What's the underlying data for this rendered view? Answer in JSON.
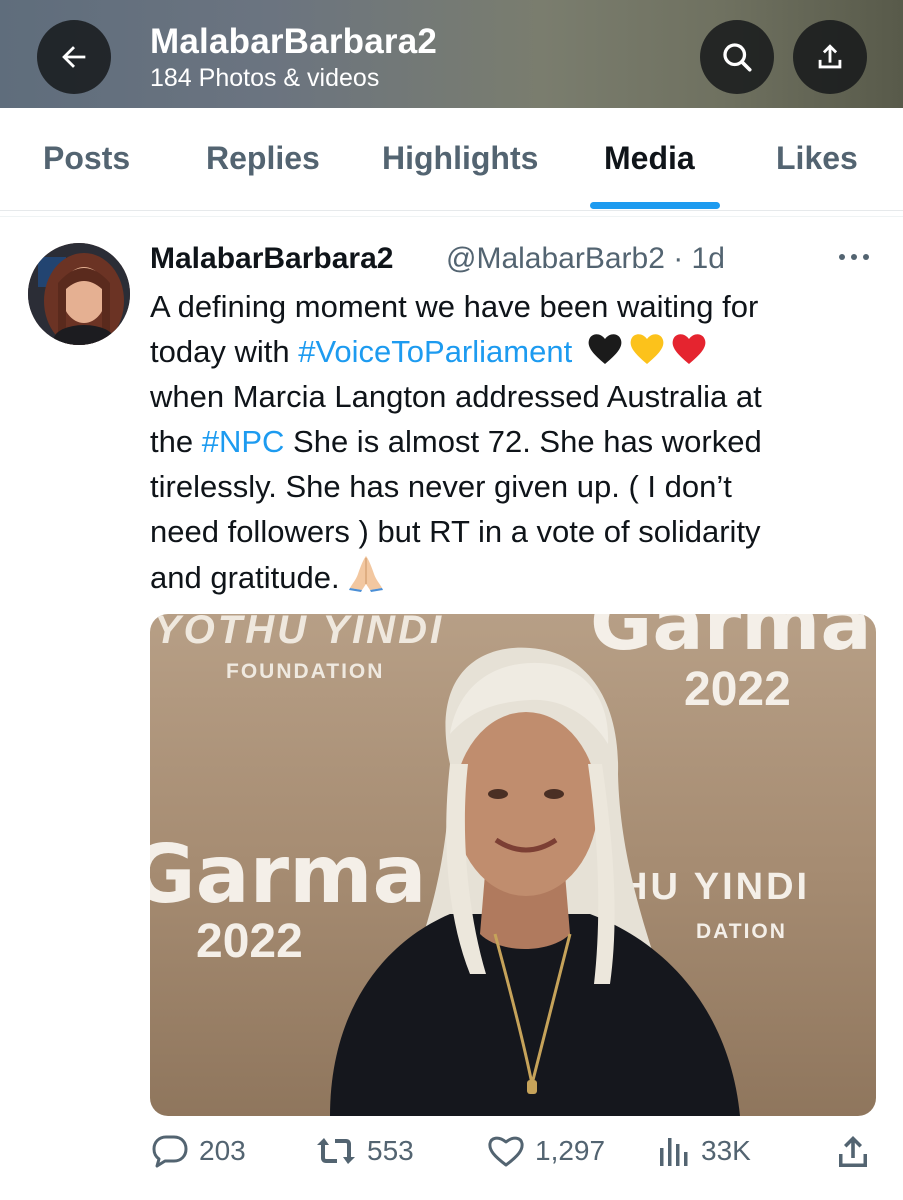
{
  "header": {
    "title": "MalabarBarbara2",
    "subtitle": "184 Photos & videos",
    "back_icon": "arrow-left-icon",
    "search_icon": "search-icon",
    "share_icon": "share-icon"
  },
  "tabs": [
    {
      "label": "Posts",
      "active": false
    },
    {
      "label": "Replies",
      "active": false
    },
    {
      "label": "Highlights",
      "active": false
    },
    {
      "label": "Media",
      "active": true
    },
    {
      "label": "Likes",
      "active": false
    }
  ],
  "tweet": {
    "author_name": "MalabarBarbara2",
    "handle_time": "@MalabarBarb2 · 1d",
    "text_lines": [
      {
        "plain": "A defining moment we have been waiting for"
      },
      {
        "pre": "today with ",
        "hashtag": "#VoiceToParliament",
        "emojis": [
          "black-heart",
          "yellow-heart",
          "red-heart"
        ]
      },
      {
        "plain": "when Marcia Langton addressed Australia at"
      },
      {
        "pre": "the ",
        "hashtag": "#NPC",
        "post": " She is almost 72. She has worked"
      },
      {
        "plain": "tirelessly. She has never given up. ( I don’t"
      },
      {
        "plain": "need followers ) but RT in a vote of solidarity"
      },
      {
        "plain": "and gratitude.",
        "emojis": [
          "folded-hands"
        ]
      }
    ],
    "photo": {
      "texts": {
        "yothu1": "YOTHU YINDI",
        "foundation1": "FOUNDATION",
        "garma1": "Garma",
        "year1": "2022",
        "garma2": "Garma",
        "year2": "2022",
        "yothu2": "HU YINDI",
        "foundation2": "DATION"
      }
    },
    "stats": {
      "replies": "203",
      "reposts": "553",
      "likes": "1,297",
      "views": "33K"
    }
  },
  "colors": {
    "accent": "#1d9bf0",
    "text_primary": "#0f1419",
    "text_secondary": "#536471"
  }
}
